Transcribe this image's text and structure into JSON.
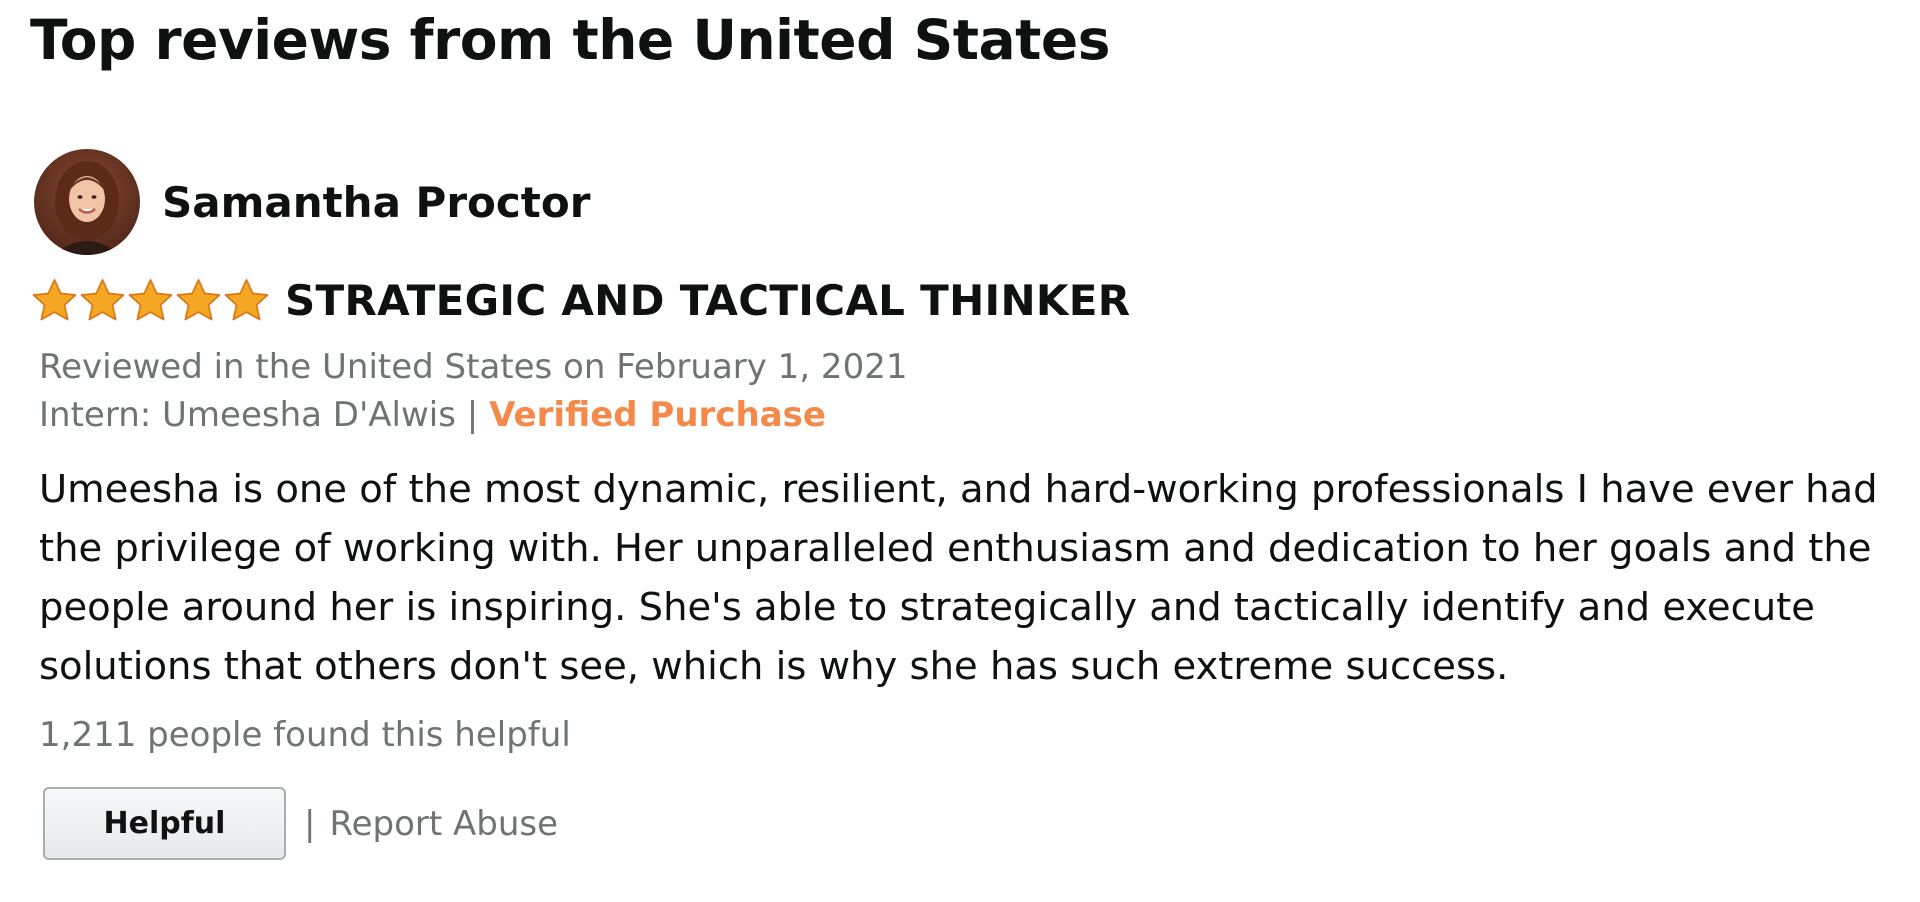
{
  "section": {
    "title": "Top reviews from the United States"
  },
  "review": {
    "reviewer_name": "Samantha Proctor",
    "avatar_icon": "reviewer-photo",
    "rating": 5,
    "rating_max": 5,
    "star_color": "#f5a623",
    "title": "STRATEGIC AND TACTICAL THINKER",
    "date_text": "Reviewed in the United States on February 1, 2021",
    "format_label": "Intern: Umeesha D'Alwis",
    "separator": "|",
    "verified_label": "Verified Purchase",
    "verified_color": "#f5894a",
    "body": "Umeesha is one of the most dynamic, resilient, and hard-working professionals I have ever had the privilege of working with. Her unparalleled enthusiasm and dedication to her goals and the people around her is inspiring. She's able to strategically and tactically identify and execute solutions that others don't see, which is why she has such extreme success.",
    "helpful_count_text": "1,211 people found this helpful"
  },
  "actions": {
    "helpful_label": "Helpful",
    "separator": "|",
    "report_label": "Report Abuse"
  }
}
